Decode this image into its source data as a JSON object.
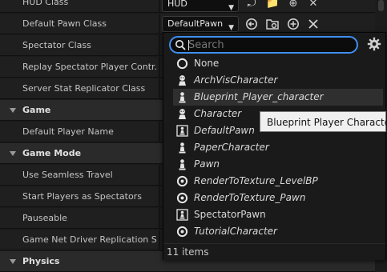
{
  "properties": [
    {
      "kind": "prop",
      "label": "HUD Class",
      "value": "HUD"
    },
    {
      "kind": "prop",
      "label": "Default Pawn Class",
      "value": "DefaultPawn"
    },
    {
      "kind": "prop",
      "label": "Spectator Class"
    },
    {
      "kind": "prop",
      "label": "Replay Spectator Player Contr..."
    },
    {
      "kind": "prop",
      "label": "Server Stat Replicator Class"
    },
    {
      "kind": "cat",
      "label": "Game"
    },
    {
      "kind": "prop",
      "label": "Default Player Name"
    },
    {
      "kind": "cat",
      "label": "Game Mode"
    },
    {
      "kind": "prop",
      "label": "Use Seamless Travel"
    },
    {
      "kind": "prop",
      "label": "Start Players as Spectators"
    },
    {
      "kind": "prop",
      "label": "Pauseable"
    },
    {
      "kind": "prop",
      "label": "Game Net Driver Replication S..."
    },
    {
      "kind": "cat",
      "label": "Physics"
    }
  ],
  "dropdown": {
    "search_placeholder": "Search",
    "items": [
      {
        "label": "None",
        "icon": "none-circle-icon",
        "italic": false
      },
      {
        "label": "ArchVisCharacter",
        "icon": "character-icon",
        "italic": true
      },
      {
        "label": "Blueprint_Player_character",
        "icon": "pawn-icon",
        "italic": true,
        "hover": true
      },
      {
        "label": "Character",
        "icon": "character-icon",
        "italic": true
      },
      {
        "label": "DefaultPawn",
        "icon": "pawn-framed-icon",
        "italic": true
      },
      {
        "label": "PaperCharacter",
        "icon": "pawn-icon",
        "italic": true
      },
      {
        "label": "Pawn",
        "icon": "pawn-icon",
        "italic": true
      },
      {
        "label": "RenderToTexture_LevelBP",
        "icon": "actor-circle-icon",
        "italic": true
      },
      {
        "label": "RenderToTexture_Pawn",
        "icon": "actor-circle-icon",
        "italic": true
      },
      {
        "label": "SpectatorPawn",
        "icon": "pawn-framed-icon",
        "italic": false
      },
      {
        "label": "TutorialCharacter",
        "icon": "actor-circle-icon",
        "italic": true
      }
    ],
    "footer": "11 items"
  },
  "tooltip": "Blueprint Player Character"
}
